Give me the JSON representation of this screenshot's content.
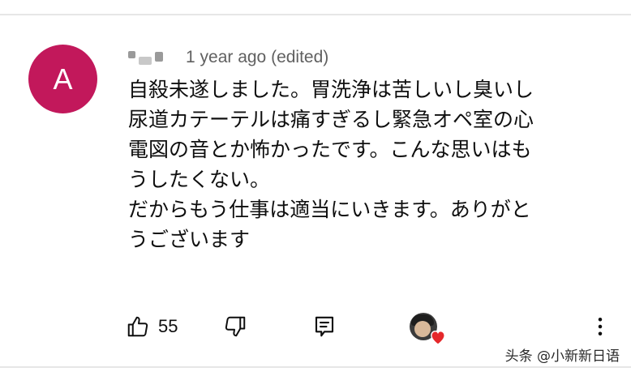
{
  "comment": {
    "avatar_letter": "A",
    "timestamp": "1 year ago (edited)",
    "lines": [
      "自殺未遂しました。胃洗浄は苦しいし臭いし",
      "尿道カテーテルは痛すぎるし緊急オペ室の心",
      "電図の音とか怖かったです。こんな思いはも",
      "うしたくない。",
      "だからもう仕事は適当にいきます。ありがと",
      "うございます"
    ]
  },
  "actions": {
    "like_count": "55",
    "like_icon": "thumbs-up-icon",
    "dislike_icon": "thumbs-down-icon",
    "reply_icon": "reply-comment-icon",
    "creator_heart_icon": "creator-heart-icon",
    "more_icon": "more-vertical-icon"
  },
  "watermark": "头条 @小新新日语",
  "colors": {
    "avatar_bg": "#c2185b",
    "heart": "#e5282b",
    "secondary_text": "#606060"
  }
}
